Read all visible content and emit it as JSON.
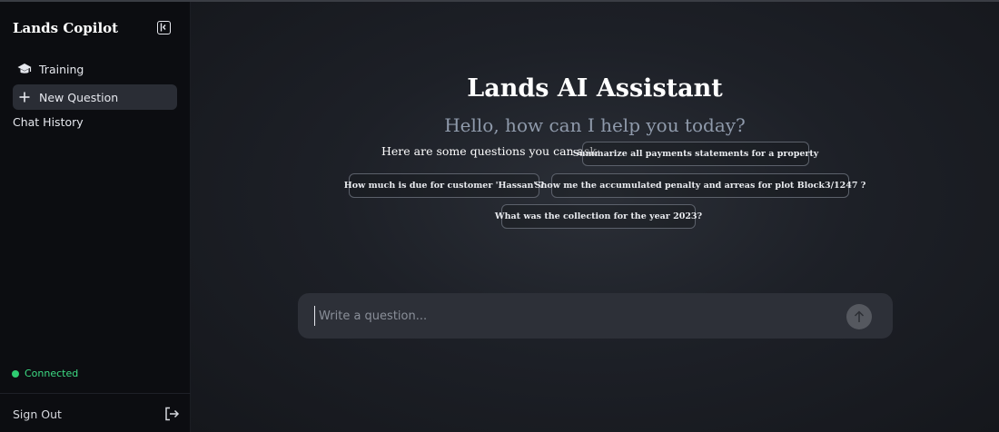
{
  "sidebar": {
    "brand": "Lands Copilot",
    "items": [
      {
        "label": "Training",
        "icon": "graduation-cap-icon"
      },
      {
        "label": "New Question",
        "icon": "plus-icon"
      }
    ],
    "history_label": "Chat History",
    "status": {
      "label": "Connected",
      "color": "#2ecc71"
    },
    "signout_label": "Sign Out"
  },
  "main": {
    "title": "Lands AI Assistant",
    "subtitle": "Hello, how can I help you today?",
    "suggestions_label": "Here are some questions you can ask:",
    "suggestions": [
      "Summarize all payments statements for a property",
      "How much is due for customer 'Hassan' ?",
      "Show me the accumulated penalty and arreas for plot Block3/1247 ?",
      "What was the collection for the year 2023?"
    ],
    "input": {
      "placeholder": "Write a question...",
      "value": ""
    }
  }
}
